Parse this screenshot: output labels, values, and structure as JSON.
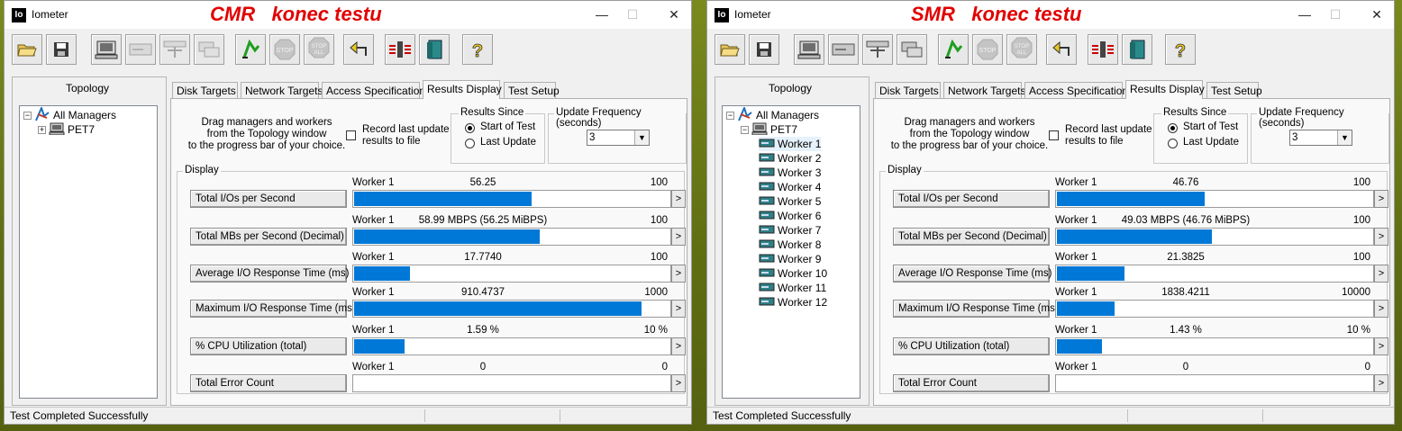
{
  "windows": [
    {
      "id": "cmr",
      "app_title": "Iometer",
      "overlay_title": "CMR   konec testu",
      "tabs": [
        "Disk Targets",
        "Network Targets",
        "Access Specifications",
        "Results Display",
        "Test Setup"
      ],
      "active_tab": "Results Display",
      "topology": {
        "label": "Topology",
        "root": "All Managers",
        "manager": "PET7",
        "expanded": false,
        "workers": []
      },
      "instructions": "Drag managers and workers\nfrom the Topology window\nto the progress bar of your choice.",
      "record_last_update": "Record last update\nresults to file",
      "results_since": {
        "label": "Results Since",
        "options": [
          "Start of Test",
          "Last Update"
        ],
        "selected": "Start of Test"
      },
      "update_frequency": {
        "label": "Update Frequency (seconds)",
        "value": "3"
      },
      "display_label": "Display",
      "metrics": [
        {
          "name": "Total I/Os per Second",
          "worker": "Worker 1",
          "value": "56.25",
          "max": "100",
          "fill": 0.5625
        },
        {
          "name": "Total MBs per Second (Decimal)",
          "worker": "Worker 1",
          "value": "58.99 MBPS (56.25 MiBPS)",
          "max": "100",
          "fill": 0.5899
        },
        {
          "name": "Average I/O Response Time (ms)",
          "worker": "Worker 1",
          "value": "17.7740",
          "max": "100",
          "fill": 0.1777
        },
        {
          "name": "Maximum I/O Response Time (ms)",
          "worker": "Worker 1",
          "value": "910.4737",
          "max": "1000",
          "fill": 0.9105
        },
        {
          "name": "% CPU Utilization (total)",
          "worker": "Worker 1",
          "value": "1.59 %",
          "max": "10 %",
          "fill": 0.159
        },
        {
          "name": "Total Error Count",
          "worker": "Worker 1",
          "value": "0",
          "max": "0",
          "fill": 0
        }
      ],
      "more_label": ">",
      "status": "Test Completed Successfully"
    },
    {
      "id": "smr",
      "app_title": "Iometer",
      "overlay_title": "SMR   konec testu",
      "tabs": [
        "Disk Targets",
        "Network Targets",
        "Access Specifications",
        "Results Display",
        "Test Setup"
      ],
      "active_tab": "Results Display",
      "topology": {
        "label": "Topology",
        "root": "All Managers",
        "manager": "PET7",
        "expanded": true,
        "workers": [
          "Worker 1",
          "Worker 2",
          "Worker 3",
          "Worker 4",
          "Worker 5",
          "Worker 6",
          "Worker 7",
          "Worker 8",
          "Worker 9",
          "Worker 10",
          "Worker 11",
          "Worker 12"
        ]
      },
      "instructions": "Drag managers and workers\nfrom the Topology window\nto the progress bar of your choice.",
      "record_last_update": "Record last update\nresults to file",
      "results_since": {
        "label": "Results Since",
        "options": [
          "Start of Test",
          "Last Update"
        ],
        "selected": "Start of Test"
      },
      "update_frequency": {
        "label": "Update Frequency (seconds)",
        "value": "3"
      },
      "display_label": "Display",
      "metrics": [
        {
          "name": "Total I/Os per Second",
          "worker": "Worker 1",
          "value": "46.76",
          "max": "100",
          "fill": 0.4676
        },
        {
          "name": "Total MBs per Second (Decimal)",
          "worker": "Worker 1",
          "value": "49.03 MBPS (46.76 MiBPS)",
          "max": "100",
          "fill": 0.4903
        },
        {
          "name": "Average I/O Response Time (ms)",
          "worker": "Worker 1",
          "value": "21.3825",
          "max": "100",
          "fill": 0.2138
        },
        {
          "name": "Maximum I/O Response Time (ms)",
          "worker": "Worker 1",
          "value": "1838.4211",
          "max": "10000",
          "fill": 0.1838
        },
        {
          "name": "% CPU Utilization (total)",
          "worker": "Worker 1",
          "value": "1.43 %",
          "max": "10 %",
          "fill": 0.143
        },
        {
          "name": "Total Error Count",
          "worker": "Worker 1",
          "value": "0",
          "max": "0",
          "fill": 0
        }
      ],
      "more_label": ">",
      "status": "Test Completed Successfully"
    }
  ],
  "toolbar_icons": [
    "open-icon",
    "save-icon",
    "new-manager-icon",
    "new-disk-worker-icon",
    "new-network-worker-icon",
    "duplicate-worker-icon",
    "start-icon",
    "stop-icon",
    "stop-all-icon",
    "reset-icon",
    "exit-icon",
    "quit-icon",
    "about-icon"
  ],
  "window_buttons": {
    "minimize": "—",
    "maximize": "☐",
    "close": "✕"
  },
  "colors": {
    "bar": "#0078d7",
    "overlay_title": "#e10000"
  }
}
